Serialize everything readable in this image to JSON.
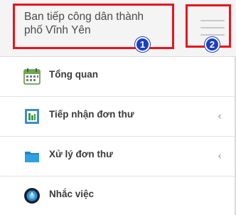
{
  "header": {
    "title": "Ban tiếp công dân thành phố Vĩnh Yên",
    "badge_left": "1",
    "badge_right": "2"
  },
  "menu": [
    {
      "label": "Tổng quan",
      "icon": "calendar-icon",
      "has_chevron": false
    },
    {
      "label": "Tiếp nhận đơn thư",
      "icon": "document-inbox-icon",
      "has_chevron": true
    },
    {
      "label": "Xử lý đơn thư",
      "icon": "folder-icon",
      "has_chevron": true
    },
    {
      "label": "Nhắc việc",
      "icon": "alarm-clock-icon",
      "has_chevron": false
    }
  ],
  "chevron_glyph": "‹",
  "colors": {
    "highlight_border": "#e8141b",
    "badge": "#1a3fc7",
    "header_bg": "#f4f4f4"
  }
}
